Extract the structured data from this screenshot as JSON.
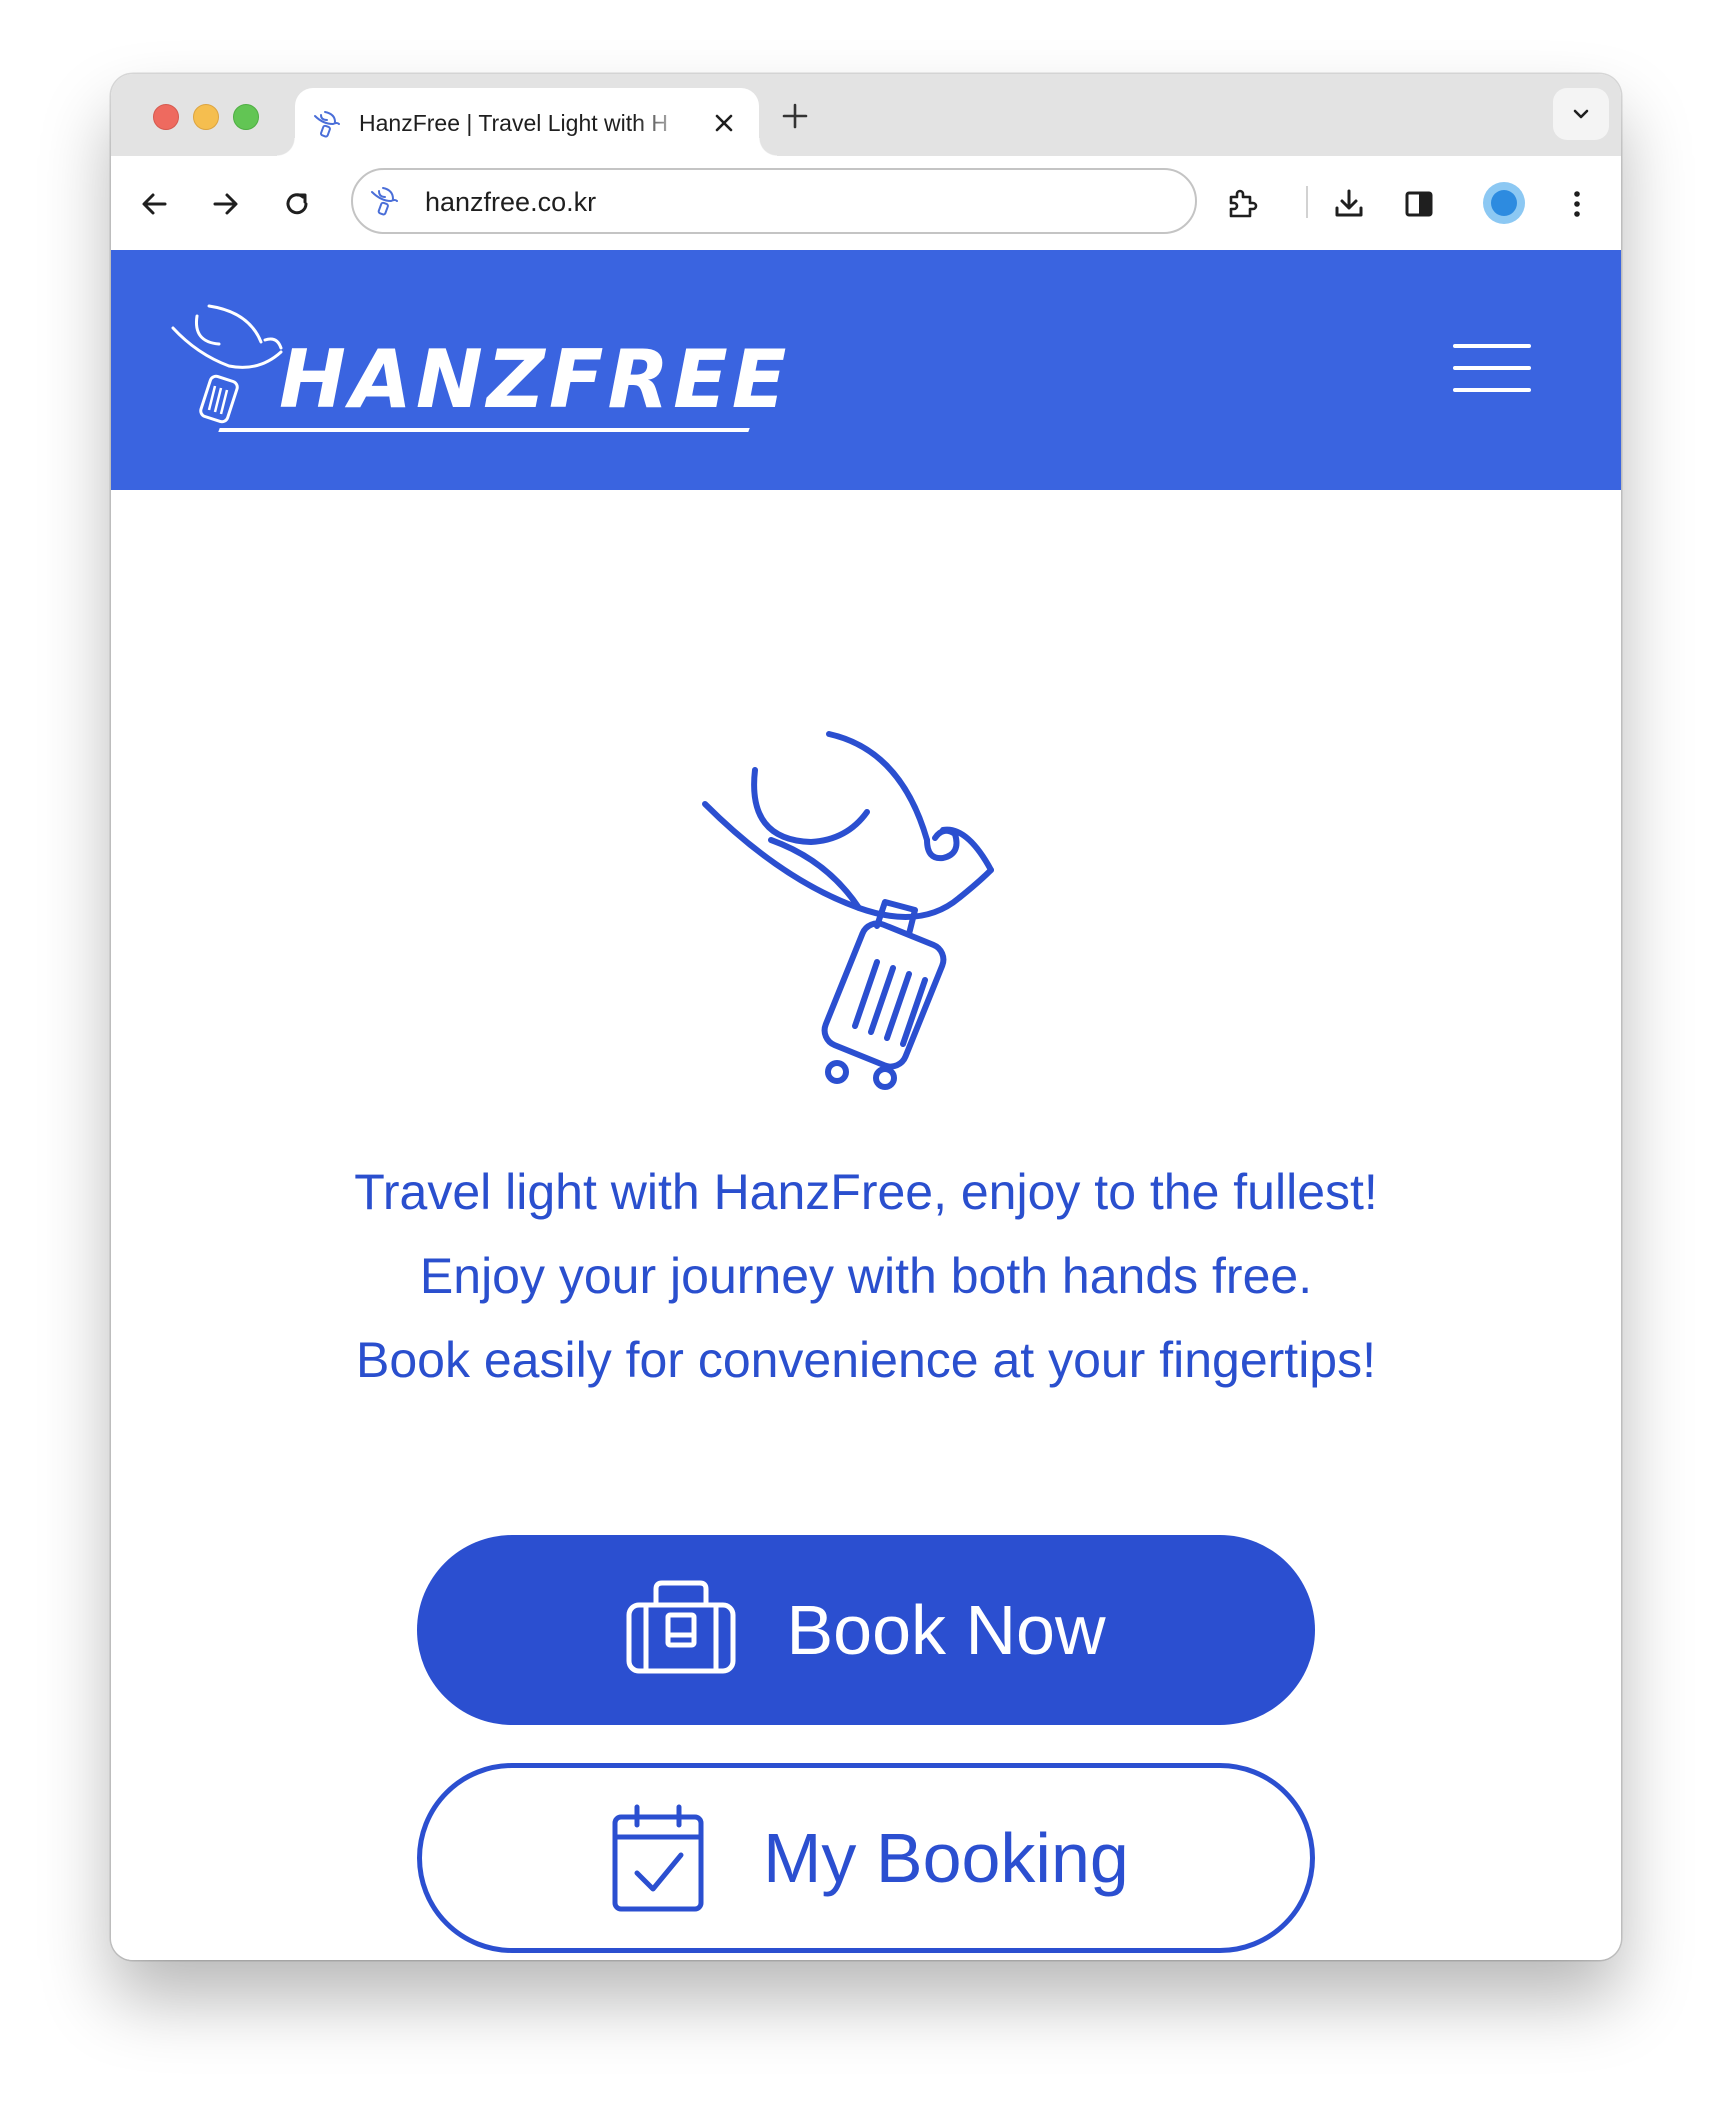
{
  "browser": {
    "tab": {
      "title": "HanzFree | Travel Light with H",
      "favicon": "hanzfree-bird-icon"
    },
    "omnibox": {
      "url": "hanzfree.co.kr"
    },
    "icons": {
      "back": "arrow-left-icon",
      "forward": "arrow-right-icon",
      "reload": "reload-icon",
      "extensions": "puzzle-icon",
      "downloads": "download-icon",
      "sidepanel": "side-panel-icon",
      "profile": "profile-avatar-icon",
      "menu": "kebab-menu-icon"
    }
  },
  "site": {
    "header": {
      "logo_text": "HANZFREE",
      "menu_icon": "hamburger-icon"
    },
    "hero": {
      "illustration": "bird-carrying-suitcase-icon"
    },
    "tagline": [
      "Travel light with HanzFree, enjoy to the fullest!",
      "Enjoy your journey with both hands free.",
      "Book easily for convenience at your fingertips!"
    ],
    "buttons": {
      "book_now": {
        "label": "Book Now",
        "icon": "luggage-icon"
      },
      "my_booking": {
        "label": "My Booking",
        "icon": "calendar-check-icon"
      }
    }
  },
  "colors": {
    "header_bg": "#3a64e0",
    "brand_blue": "#2b4fd0",
    "text_blue": "#2a4fce"
  }
}
